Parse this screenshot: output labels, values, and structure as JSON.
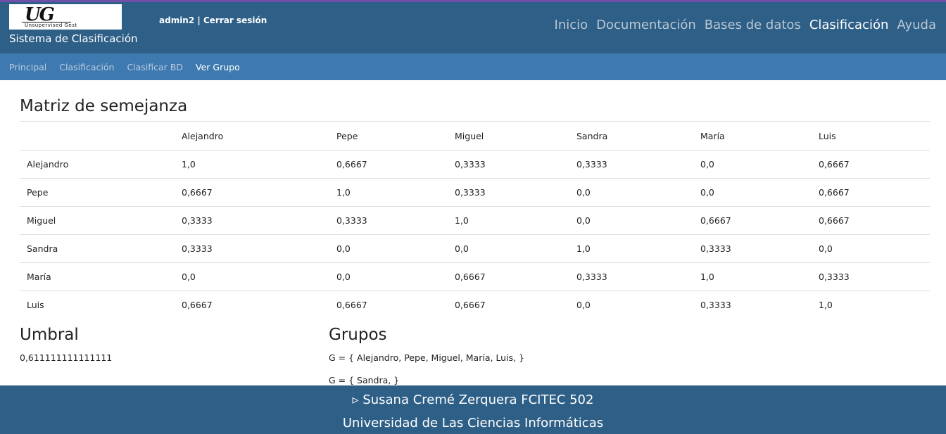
{
  "header": {
    "logo_text": "UG",
    "logo_subtitle": "Unsupervised Gest",
    "app_title": "Sistema de Clasificación",
    "username": "admin2",
    "separator": " | ",
    "logout_label": "Cerrar sesión",
    "nav": [
      {
        "label": "Inicio",
        "active": false
      },
      {
        "label": "Documentación",
        "active": false
      },
      {
        "label": "Bases de datos",
        "active": false
      },
      {
        "label": "Clasificación",
        "active": true
      },
      {
        "label": "Ayuda",
        "active": false
      }
    ]
  },
  "breadcrumb": [
    "Principal",
    "Clasificación",
    "Clasificar BD",
    "Ver Grupo"
  ],
  "matrix": {
    "title": "Matriz de semejanza",
    "columns": [
      "Alejandro",
      "Pepe",
      "Miguel",
      "Sandra",
      "María",
      "Luis"
    ],
    "rows": [
      {
        "name": "Alejandro",
        "values": [
          "1,0",
          "0,6667",
          "0,3333",
          "0,3333",
          "0,0",
          "0,6667"
        ]
      },
      {
        "name": "Pepe",
        "values": [
          "0,6667",
          "1,0",
          "0,3333",
          "0,0",
          "0,0",
          "0,6667"
        ]
      },
      {
        "name": "Miguel",
        "values": [
          "0,3333",
          "0,3333",
          "1,0",
          "0,0",
          "0,6667",
          "0,6667"
        ]
      },
      {
        "name": "Sandra",
        "values": [
          "0,3333",
          "0,0",
          "0,0",
          "1,0",
          "0,3333",
          "0,0"
        ]
      },
      {
        "name": "María",
        "values": [
          "0,0",
          "0,0",
          "0,6667",
          "0,3333",
          "1,0",
          "0,3333"
        ]
      },
      {
        "name": "Luis",
        "values": [
          "0,6667",
          "0,6667",
          "0,6667",
          "0,0",
          "0,3333",
          "1,0"
        ]
      }
    ]
  },
  "umbral": {
    "title": "Umbral",
    "value": "0,611111111111111"
  },
  "groups": {
    "title": "Grupos",
    "items": [
      "G = { Alejandro, Pepe, Miguel, María, Luis, }",
      "G = { Sandra, }"
    ]
  },
  "footer": {
    "line1": "▹ Susana Cremé Zerquera FCITEC 502",
    "line2": "Universidad de Las Ciencias Informáticas"
  }
}
